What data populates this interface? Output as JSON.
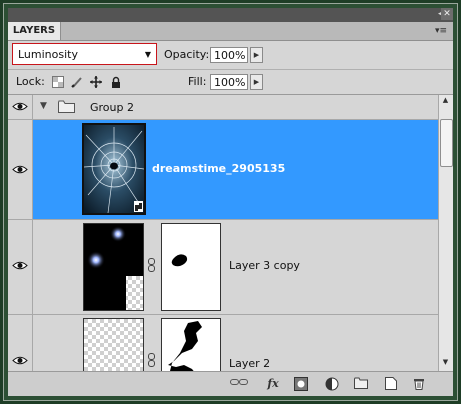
{
  "panel": {
    "title": "LAYERS",
    "collapse_glyph": "◂◂",
    "close_glyph": "✕",
    "menu_glyph": "▾≡"
  },
  "blend": {
    "mode": "Luminosity"
  },
  "opacity": {
    "label": "Opacity:",
    "value": "100%"
  },
  "lock": {
    "label": "Lock:"
  },
  "fill": {
    "label": "Fill:",
    "value": "100%"
  },
  "layers": {
    "group": {
      "name": "Group 2"
    },
    "items": [
      {
        "name": "dreamstime_2905135",
        "selected": true
      },
      {
        "name": "Layer 3 copy",
        "selected": false
      },
      {
        "name": "Layer 2",
        "selected": false
      }
    ]
  },
  "footer": {
    "fx_label": "fx"
  },
  "colors": {
    "selection": "#3399ff",
    "panel_bg": "#d6d6d6",
    "blend_border": "#c8151b",
    "frame": "#1e3d26"
  }
}
